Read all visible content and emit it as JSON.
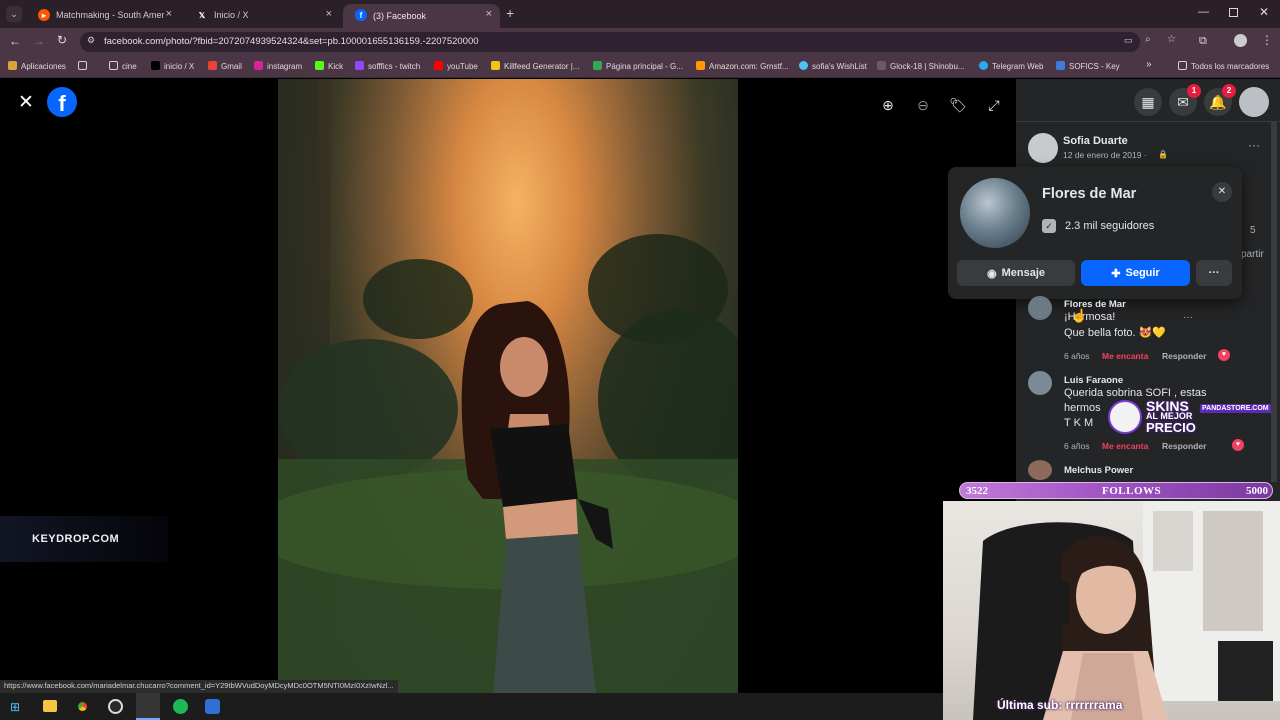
{
  "browser": {
    "tabs": [
      {
        "title": "Matchmaking - South America",
        "active": false
      },
      {
        "title": "Inicio / X",
        "active": false
      },
      {
        "title": "(3) Facebook",
        "active": true
      }
    ],
    "new_tab": "+",
    "url": "facebook.com/photo/?fbid=2072074939524324&set=pb.100001655136159.-2207520000",
    "bookmarks": [
      "Aplicaciones",
      "cine",
      "inicio / X",
      "Gmail",
      "instagram",
      "Kick",
      "sofffics - twitch",
      "youTube",
      "Killfeed Generator |...",
      "Página principal - G...",
      "Amazon.com: Grnstf...",
      "sofia's WishList",
      "Glock-18 | Shinobu...",
      "Telegram Web",
      "SOFICS - Key"
    ],
    "other_bookmarks": "Todos los marcadores"
  },
  "facebook": {
    "logo": "f",
    "badges": {
      "messenger": "1",
      "notifications": "2"
    },
    "post_author": "Sofia Duarte",
    "post_date": "12 de enero de 2019 ·",
    "partial_count": "5",
    "partial_share": "partir",
    "popover": {
      "name": "Flores de Mar",
      "followers": "2.3 mil seguidores",
      "message_label": "Mensaje",
      "follow_label": "Seguir",
      "more_label": "···"
    },
    "comments": [
      {
        "author": "Flores de Mar",
        "line1": "¡Hermosa!",
        "line2": "Que bella foto. 😻💛",
        "age": "6 años",
        "like": "Me encanta",
        "reply": "Responder"
      },
      {
        "author": "Luis Faraone",
        "line1": "Querida sobrina SOFI , estas",
        "line2": "hermos",
        "line3": "T K M",
        "age": "6 años",
        "like": "Me encanta",
        "reply": "Responder"
      },
      {
        "author": "Melchus Power",
        "line1": "",
        "line2": ""
      }
    ]
  },
  "overlays": {
    "keydrop": "KEYDROP.COM",
    "skins_line1": "SKINS",
    "skins_line2": "AL MEJOR",
    "skins_line3": "PRECIO",
    "pandastore": "PANDASTORE.COM",
    "follows_current": "3522",
    "follows_label": "FOLLOWS",
    "follows_goal": "5000",
    "last_sub": "Última sub: rrrrrrrama"
  },
  "status_url": "https://www.facebook.com/mariadelmar.chucarro?comment_id=Y29tbWVudDoyMDcyMDc0OTM5NTI0MzI0XzIwNzl...",
  "colors": {
    "fb_blue": "#0866ff",
    "like_red": "#f3425f",
    "panel_bg": "#242526",
    "chrome_frame": "#4a3645"
  }
}
